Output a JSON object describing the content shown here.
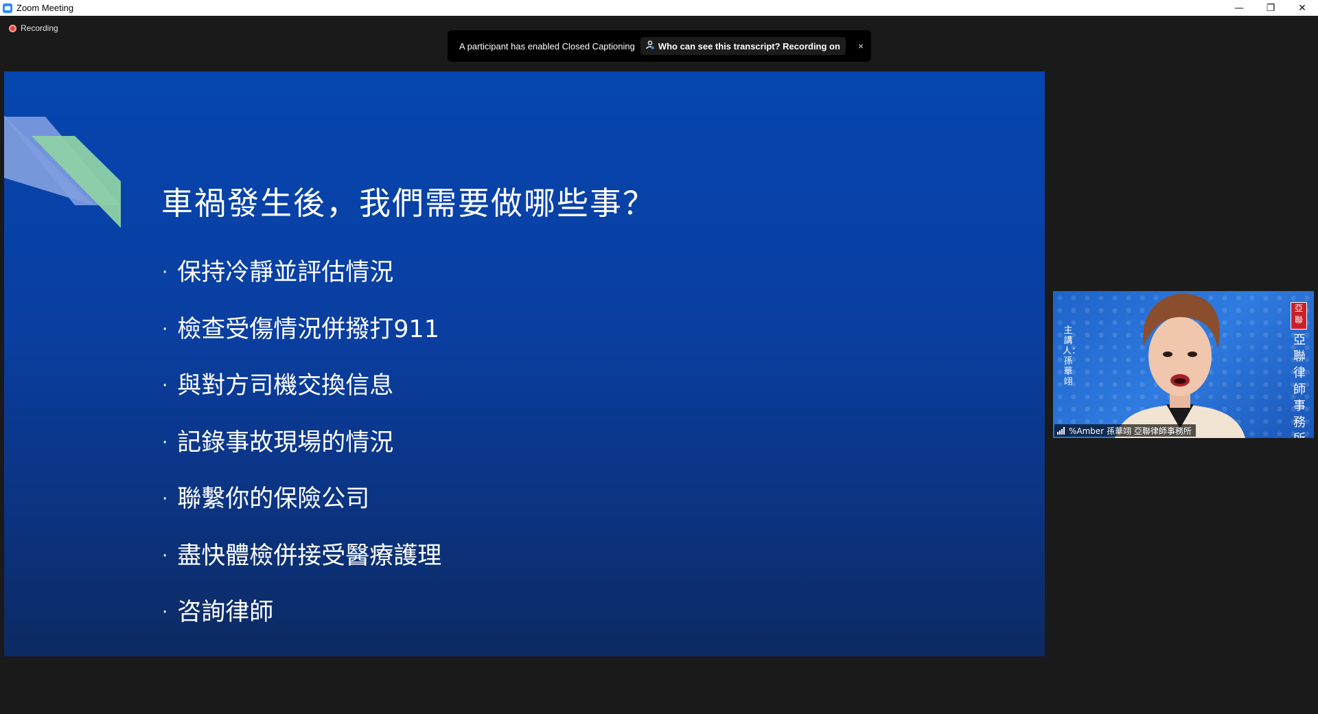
{
  "window": {
    "title": "Zoom Meeting",
    "controls": {
      "minimize": "—",
      "restore": "❐",
      "close": "✕"
    }
  },
  "recording": {
    "label": "Recording",
    "color": "#e8453c"
  },
  "cc_banner": {
    "message": "A participant has enabled Closed Captioning",
    "transcript_link": "Who can see this transcript? Recording on",
    "close": "×"
  },
  "slide": {
    "title": "車禍發生後，我們需要做哪些事？",
    "bullet_marker": "·",
    "bullets": [
      "保持冷靜並評估情況",
      "檢查受傷情況併撥打911",
      "與對方司機交換信息",
      "記錄事故現場的情況",
      "聯繫你的保險公司",
      "盡快體檢併接受醫療護理",
      "咨詢律師"
    ],
    "background_color": "#0546b0"
  },
  "video": {
    "participant_name": "%Amber 孫華翊 亞聯律師事務所",
    "left_caption": "主講人：孫華翊",
    "right_caption": "亞聯律師事務所",
    "seal_text": "亞聯"
  }
}
